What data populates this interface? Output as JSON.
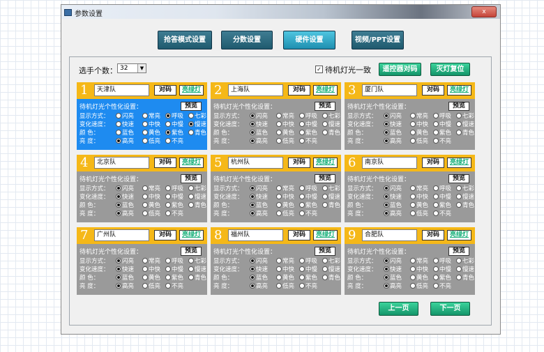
{
  "window": {
    "title": "参数设置",
    "close_label": "x"
  },
  "top_tabs": [
    {
      "label": "抢答模式设置",
      "active": false
    },
    {
      "label": "分数设置",
      "active": false
    },
    {
      "label": "硬件设置",
      "active": true
    },
    {
      "label": "视频/PPT设置",
      "active": false
    }
  ],
  "controls": {
    "player_count_label": "选手个数：",
    "player_count_value": "32",
    "standby_checked": true,
    "standby_label": "待机灯光一致",
    "remote_pair_label": "遥控器对码",
    "lights_reset_label": "灭灯复位"
  },
  "card_labels": {
    "pair": "对码",
    "light_green": "亮绿灯",
    "personalize": "待机灯光个性化设置：",
    "preview": "预览",
    "rows": [
      "显示方式：",
      "变化速度：",
      "颜    色：",
      "亮    度："
    ]
  },
  "options": {
    "display": [
      "闪亮",
      "常亮",
      "呼吸",
      "七彩"
    ],
    "speed": [
      "快速",
      "中快",
      "中慢",
      "慢速"
    ],
    "color": [
      "蓝色",
      "黄色",
      "紫色",
      "青色"
    ],
    "brightness": [
      "高亮",
      "低亮",
      "不亮"
    ]
  },
  "teams": [
    {
      "num": "1",
      "name": "天津队",
      "selected": true
    },
    {
      "num": "2",
      "name": "上海队",
      "selected": false
    },
    {
      "num": "3",
      "name": "厦门队",
      "selected": false
    },
    {
      "num": "4",
      "name": "北京队",
      "selected": false
    },
    {
      "num": "5",
      "name": "杭州队",
      "selected": false
    },
    {
      "num": "6",
      "name": "南京队",
      "selected": false
    },
    {
      "num": "7",
      "name": "广州队",
      "selected": false
    },
    {
      "num": "8",
      "name": "福州队",
      "selected": false
    },
    {
      "num": "9",
      "name": "合肥队",
      "selected": false
    }
  ],
  "card_state": {
    "selected": {
      "display": "呼吸",
      "speed": "慢速",
      "color": "紫色",
      "brightness": "高亮"
    }
  },
  "paging": {
    "prev_label": "上一页",
    "next_label": "下一页"
  }
}
